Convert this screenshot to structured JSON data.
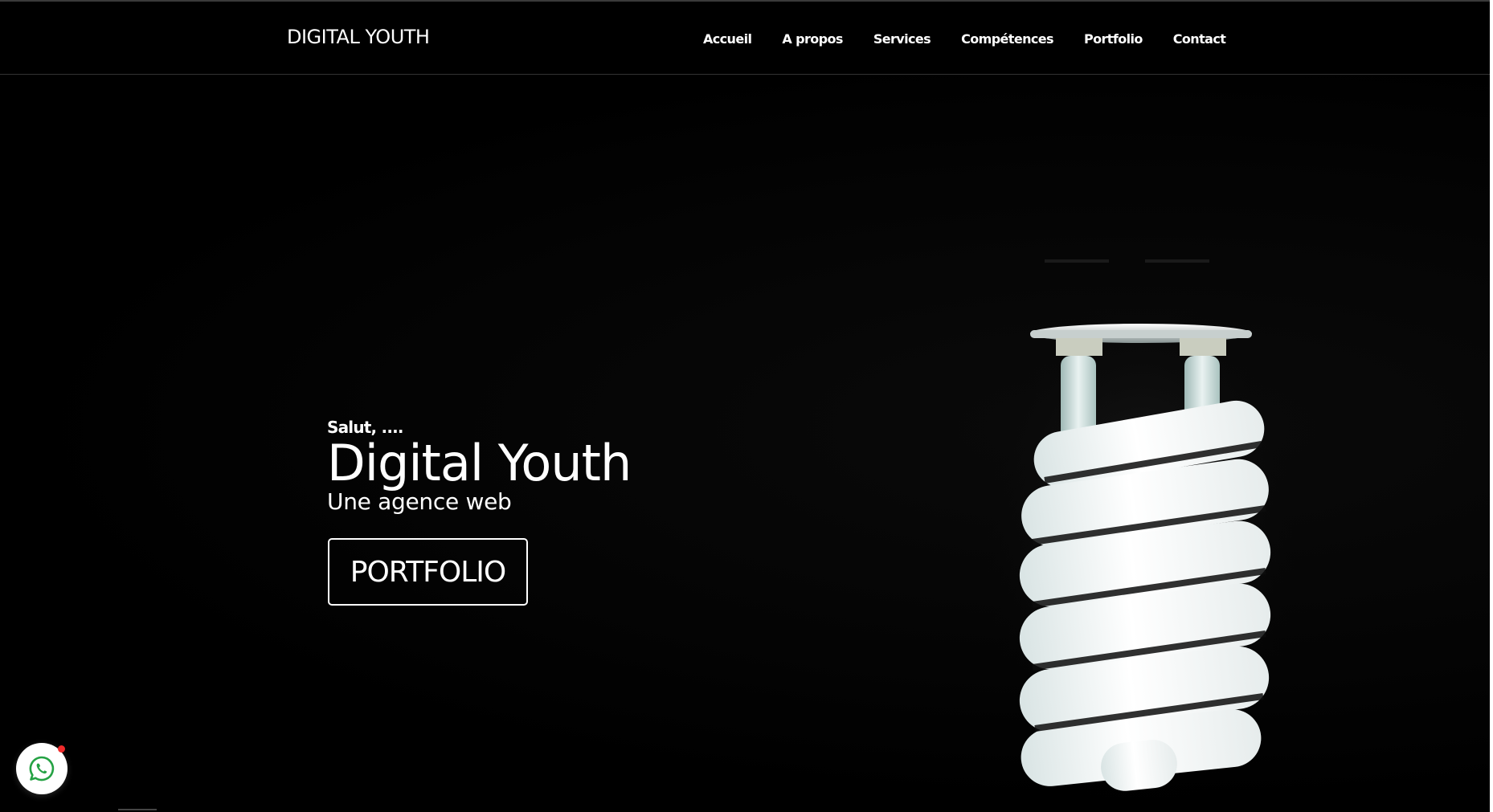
{
  "navbar": {
    "brand": "DIGITAL YOUTH",
    "links": [
      {
        "label": "Accueil"
      },
      {
        "label": "A propos"
      },
      {
        "label": "Services"
      },
      {
        "label": "Compétences"
      },
      {
        "label": "Portfolio"
      },
      {
        "label": "Contact"
      }
    ]
  },
  "hero": {
    "greeting": "Salut, ....",
    "headline": "Digital Youth",
    "tagline": "Une agence web",
    "button_label": "PORTFOLIO"
  },
  "floating": {
    "whatsapp_icon": "whatsapp-icon",
    "notification_color": "#f02a2a"
  },
  "colors": {
    "background": "#000000",
    "text": "#ffffff"
  }
}
